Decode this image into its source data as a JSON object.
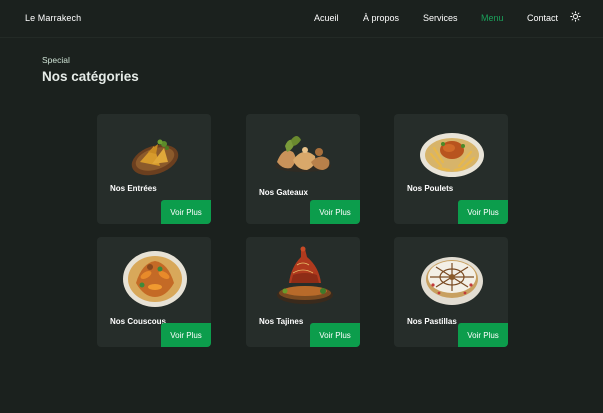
{
  "nav": {
    "brand": "Le Marrakech",
    "links": [
      {
        "label": "Acueil"
      },
      {
        "label": "À propos"
      },
      {
        "label": "Services"
      },
      {
        "label": "Menu"
      },
      {
        "label": "Contact"
      }
    ],
    "active_index": 3,
    "accent_color": "#1aa05a",
    "theme_toggle_icon": "sun-icon"
  },
  "section": {
    "eyebrow": "Special",
    "title": "Nos catégories"
  },
  "categories": [
    {
      "name": "Nos Entrées",
      "button": "Voir Plus",
      "icon": "entrees-dish-icon"
    },
    {
      "name": "Nos Gateaux",
      "button": "Voir Plus",
      "icon": "gateaux-dish-icon"
    },
    {
      "name": "Nos Poulets",
      "button": "Voir Plus",
      "icon": "poulets-dish-icon"
    },
    {
      "name": "Nos Couscous",
      "button": "Voir Plus",
      "icon": "couscous-dish-icon"
    },
    {
      "name": "Nos Tajines",
      "button": "Voir Plus",
      "icon": "tajine-dish-icon"
    },
    {
      "name": "Nos Pastillas",
      "button": "Voir Plus",
      "icon": "pastilla-dish-icon"
    }
  ],
  "button_color": "#0c9d4c"
}
